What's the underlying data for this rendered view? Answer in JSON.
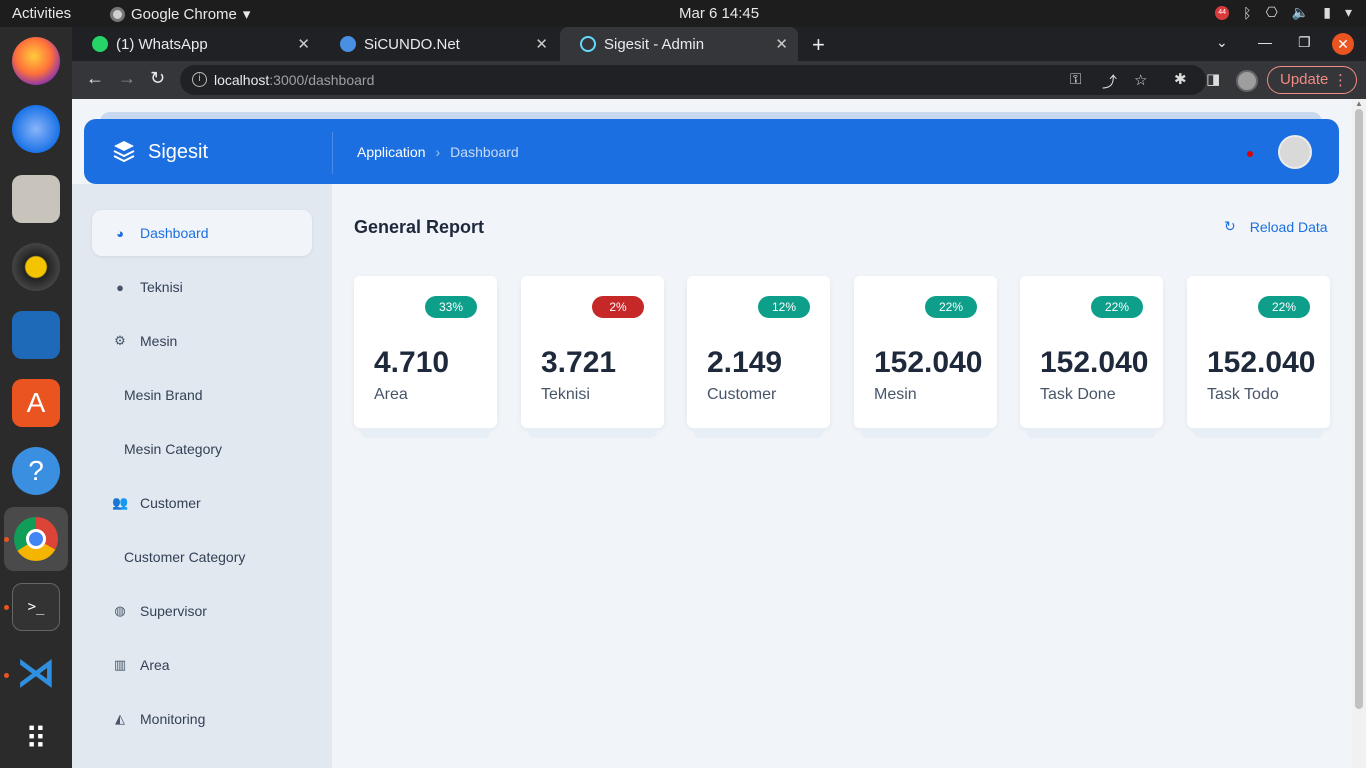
{
  "os": {
    "activities": "Activities",
    "app_name": "Google Chrome",
    "clock": "Mar 6  14:45",
    "notif_count": "44"
  },
  "browser": {
    "tabs": [
      {
        "title": "(1) WhatsApp",
        "color": "#25d366"
      },
      {
        "title": "SiCUNDO.Net",
        "color": "#4a90e2"
      },
      {
        "title": "Sigesit - Admin",
        "color": "#61dafb"
      }
    ],
    "url_host": "localhost",
    "url_path": ":3000/dashboard",
    "update_label": "Update"
  },
  "app": {
    "brand": "Sigesit",
    "breadcrumb": [
      "Application",
      "Dashboard"
    ],
    "accent": "#1c6fe0"
  },
  "sidebar": {
    "items": [
      {
        "label": "Dashboard",
        "icon": "dashboard-icon",
        "active": true
      },
      {
        "label": "Teknisi",
        "icon": "user-icon"
      },
      {
        "label": "Mesin",
        "icon": "cogs-icon"
      },
      {
        "label": "Mesin Brand",
        "sub": true
      },
      {
        "label": "Mesin Category",
        "sub": true
      },
      {
        "label": "Customer",
        "icon": "users-icon"
      },
      {
        "label": "Customer Category",
        "sub": true
      },
      {
        "label": "Supervisor",
        "icon": "globe-icon"
      },
      {
        "label": "Area",
        "icon": "map-icon"
      },
      {
        "label": "Monitoring",
        "icon": "chart-area-icon"
      }
    ]
  },
  "report": {
    "title": "General Report",
    "reload_label": "Reload Data",
    "cards": [
      {
        "badge": "33%",
        "status": "up",
        "value": "4.710",
        "label": "Area"
      },
      {
        "badge": "2%",
        "status": "down",
        "value": "3.721",
        "label": "Teknisi"
      },
      {
        "badge": "12%",
        "status": "up",
        "value": "2.149",
        "label": "Customer"
      },
      {
        "badge": "22%",
        "status": "up",
        "value": "152.040",
        "label": "Mesin"
      },
      {
        "badge": "22%",
        "status": "up",
        "value": "152.040",
        "label": "Task Done"
      },
      {
        "badge": "22%",
        "status": "up",
        "value": "152.040",
        "label": "Task Todo"
      }
    ]
  }
}
